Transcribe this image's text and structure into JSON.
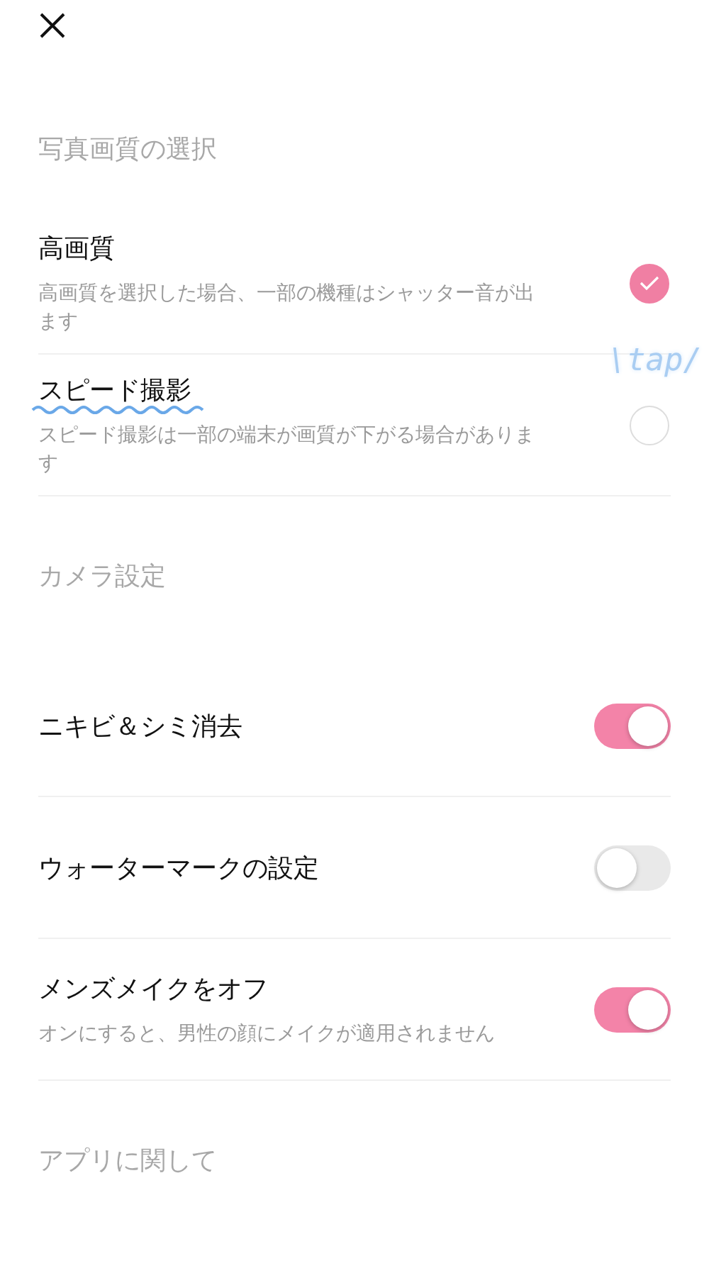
{
  "sections": [
    {
      "title": "写真画質の選択",
      "items": [
        {
          "kind": "radio",
          "label": "高画質",
          "description": "高画質を選択した場合、一部の機種はシャッター音が出ます",
          "selected": true
        },
        {
          "kind": "radio",
          "label": "スピード撮影",
          "description": "スピード撮影は一部の端末が画質が下がる場合があります",
          "selected": false,
          "annotation": "\\tap/"
        }
      ]
    },
    {
      "title": "カメラ設定",
      "items": [
        {
          "kind": "toggle",
          "label": "ニキビ＆シミ消去",
          "on": true
        },
        {
          "kind": "toggle",
          "label": "ウォーターマークの設定",
          "on": false
        },
        {
          "kind": "toggle",
          "label": "メンズメイクをオフ",
          "description": "オンにすると、男性の顔にメイクが適用されません",
          "on": true
        }
      ]
    },
    {
      "title": "アプリに関して"
    }
  ]
}
